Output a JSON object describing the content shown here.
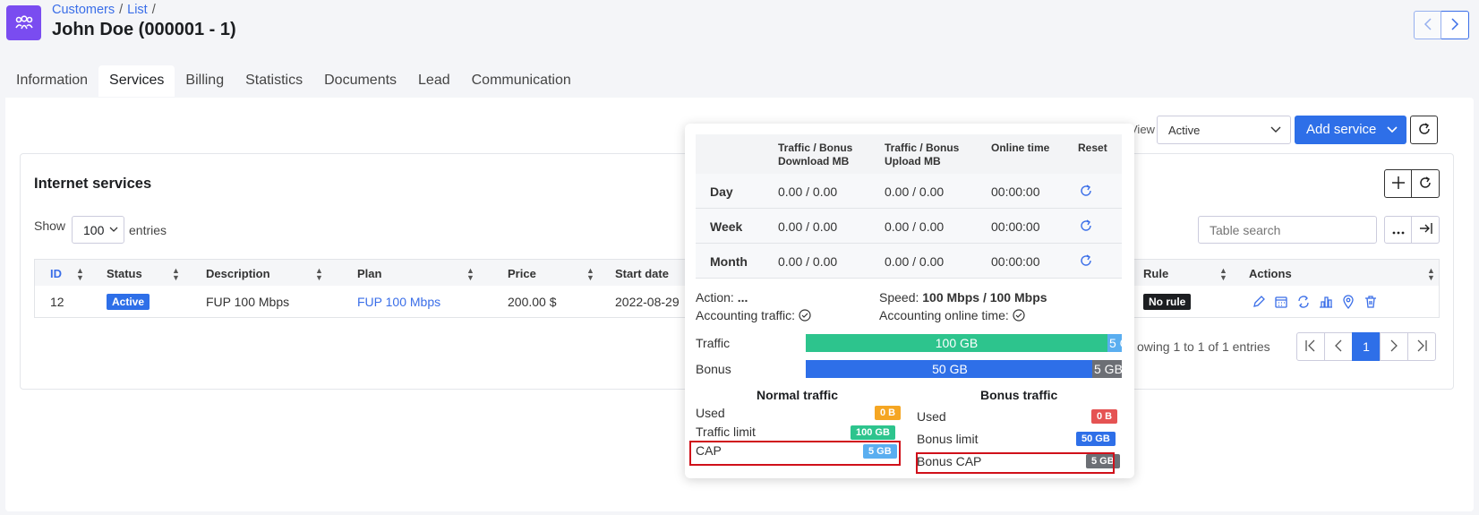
{
  "breadcrumb": {
    "customers": "Customers",
    "list": "List",
    "sep1": "/",
    "sep2": "/"
  },
  "page": {
    "title": "John Doe (000001 - 1)"
  },
  "tabs": [
    "Information",
    "Services",
    "Billing",
    "Statistics",
    "Documents",
    "Lead",
    "Communication"
  ],
  "toolbar": {
    "view_label": "View",
    "view_value": "Active",
    "add_service": "Add service"
  },
  "card": {
    "title": "Internet services",
    "show_label": "Show",
    "show_value": "100",
    "entries_label": "entries",
    "search_placeholder": "Table search"
  },
  "table": {
    "headers": {
      "id": "ID",
      "status": "Status",
      "description": "Description",
      "plan": "Plan",
      "price": "Price",
      "start_date": "Start date",
      "rule": "Rule",
      "actions": "Actions"
    },
    "row": {
      "id": "12",
      "status": "Active",
      "description": "FUP 100 Mbps",
      "plan": "FUP 100 Mbps",
      "price": "200.00 $",
      "start_date": "2022-08-29",
      "rule": "No rule"
    }
  },
  "pagination": {
    "showing": "owing 1 to 1 of 1 entries",
    "current": "1"
  },
  "popover": {
    "headers": {
      "download": "Traffic / Bonus\nDownload MB",
      "upload": "Traffic / Bonus\nUpload MB",
      "online": "Online time",
      "reset": "Reset"
    },
    "rows": [
      {
        "label": "Day",
        "download": "0.00 / 0.00",
        "upload": "0.00 / 0.00",
        "online": "00:00:00"
      },
      {
        "label": "Week",
        "download": "0.00 / 0.00",
        "upload": "0.00 / 0.00",
        "online": "00:00:00"
      },
      {
        "label": "Month",
        "download": "0.00 / 0.00",
        "upload": "0.00 / 0.00",
        "online": "00:00:00"
      }
    ],
    "action_label": "Action:",
    "action_value": "...",
    "speed_label": "Speed:",
    "speed_value": "100 Mbps / 100 Mbps",
    "acct_traffic_label": "Accounting traffic:",
    "acct_online_label": "Accounting online time:",
    "traffic_label": "Traffic",
    "traffic_value": "100 GB",
    "traffic_cap": "5 G",
    "bonus_label": "Bonus",
    "bonus_value": "50 GB",
    "bonus_cap": "5 GB",
    "normal_title": "Normal traffic",
    "bonus_title": "Bonus traffic",
    "normal": {
      "used_label": "Used",
      "used": "0 B",
      "limit_label": "Traffic limit",
      "limit": "100 GB",
      "cap_label": "CAP",
      "cap": "5 GB"
    },
    "bonus": {
      "used_label": "Used",
      "used": "0 B",
      "limit_label": "Bonus limit",
      "limit": "50 GB",
      "cap_label": "Bonus CAP",
      "cap": "5 GB"
    }
  },
  "colors": {
    "primary": "#2e6fe8",
    "app_icon": "#7a4cf0",
    "green": "#2dc48d",
    "orange": "#f5a623",
    "red": "#e55353",
    "light_blue": "#5aaef0",
    "dark_gray": "#6c6f75"
  }
}
